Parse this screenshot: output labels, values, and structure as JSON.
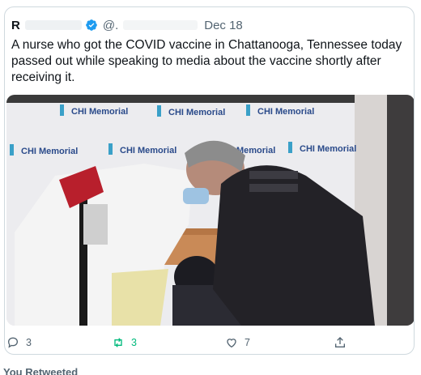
{
  "tweet": {
    "author_initial": "R",
    "handle": "@.",
    "dot": "·",
    "date": "Dec 18",
    "text": "A nurse who got the COVID vaccine in Chattanooga, Tennessee today passed out while speaking to media about the vaccine shortly after receiving it.",
    "verified_icon": "verified-badge-icon"
  },
  "media": {
    "backdrop_logo_text": "CHI Memorial"
  },
  "actions": {
    "replies": "3",
    "retweets": "3",
    "likes": "7",
    "reply_icon": "reply-icon",
    "retweet_icon": "retweet-icon",
    "like_icon": "heart-icon",
    "share_icon": "share-icon"
  },
  "colors": {
    "accent": "#1d9bf0",
    "retweet_active": "#00ba7c",
    "secondary_text": "#536471"
  },
  "footer": {
    "retweeted_label": "You Retweeted"
  }
}
